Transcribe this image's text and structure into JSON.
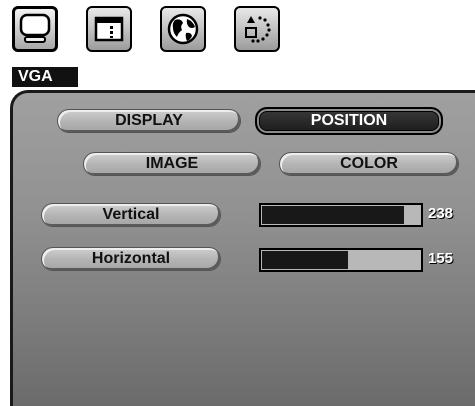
{
  "tabs": [
    {
      "name": "monitor-icon",
      "active": true
    },
    {
      "name": "panel-icon",
      "active": false
    },
    {
      "name": "globe-icon",
      "active": false
    },
    {
      "name": "dotted-circle-icon",
      "active": false
    }
  ],
  "input_label": "VGA",
  "menu": {
    "display_label": "DISPLAY",
    "position_label": "POSITION",
    "image_label": "IMAGE",
    "color_label": "COLOR",
    "selected": "POSITION"
  },
  "sliders": {
    "vertical": {
      "label": "Vertical",
      "value": "238",
      "fill_fraction": 0.9
    },
    "horizontal": {
      "label": "Horizontal",
      "value": "155",
      "fill_fraction": 0.55
    }
  },
  "colors": {
    "panel": "#8f8f8f",
    "selected_button": "#1b1b1b",
    "bar_fill": "#181818",
    "bar_bg": "#b8b8b8"
  }
}
